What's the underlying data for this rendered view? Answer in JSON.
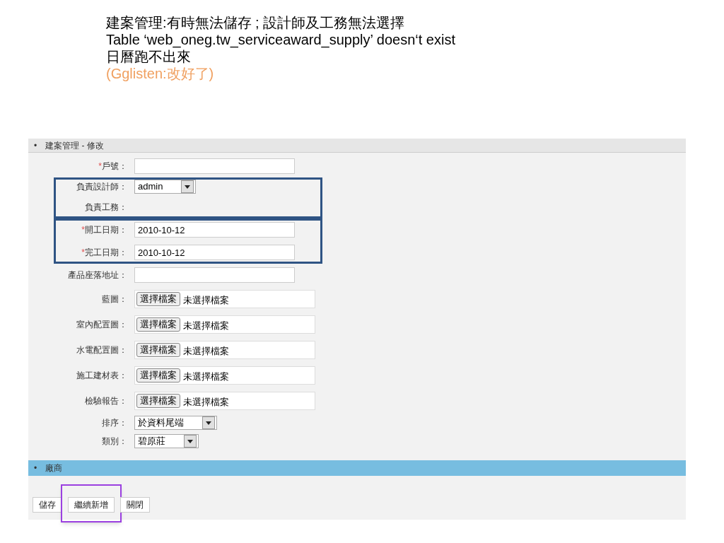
{
  "notes": [
    {
      "kind": "normal",
      "text": "建案管理:有時無法儲存 ; 設計師及工務無法選擇"
    },
    {
      "kind": "normal",
      "text": "Table ‘web_oneg.tw_serviceaward_supply’ doesn‘t exist"
    },
    {
      "kind": "normal",
      "text": "日曆跑不出來"
    },
    {
      "kind": "comment",
      "text": "(Gglisten:改好了)"
    }
  ],
  "form": {
    "title": "建案管理 - 修改",
    "groups": [
      {
        "framed": false,
        "fields": [
          {
            "label": "戶號",
            "required": true,
            "kind": "text"
          }
        ]
      },
      {
        "framed": true,
        "fields": [
          {
            "label": "負責設計師",
            "required": false,
            "kind": "select",
            "value": "admin"
          },
          {
            "label": "負責工務",
            "required": false,
            "kind": "empty"
          }
        ]
      },
      {
        "framed": true,
        "fields": [
          {
            "label": "開工日期",
            "required": true,
            "kind": "text",
            "value": "2010-10-12"
          },
          {
            "label": "完工日期",
            "required": true,
            "kind": "text",
            "value": "2010-10-12"
          }
        ]
      },
      {
        "framed": false,
        "fields": [
          {
            "label": "產品座落地址",
            "required": false,
            "kind": "text"
          },
          {
            "label": "藍圖",
            "required": false,
            "kind": "file",
            "button": "選擇檔案",
            "value": "未選擇檔案"
          },
          {
            "label": "室內配置圖",
            "required": false,
            "kind": "file",
            "button": "選擇檔案",
            "value": "未選擇檔案"
          },
          {
            "label": "水電配置圖",
            "required": false,
            "kind": "file",
            "button": "選擇檔案",
            "value": "未選擇檔案"
          },
          {
            "label": "施工建材表",
            "required": false,
            "kind": "file",
            "button": "選擇檔案",
            "value": "未選擇檔案"
          },
          {
            "label": "檢驗報告",
            "required": false,
            "kind": "file",
            "button": "選擇檔案",
            "value": "未選擇檔案"
          },
          {
            "label": "排序",
            "required": false,
            "kind": "select",
            "value": "於資料尾端"
          },
          {
            "label": "類別",
            "required": false,
            "kind": "select",
            "value": "碧原莊"
          }
        ]
      }
    ],
    "required_mark": "*",
    "colon": "：",
    "bullet": "•",
    "section": "廠商",
    "buttons": [
      {
        "label": "儲存",
        "highlighted": false
      },
      {
        "label": "繼續新增",
        "highlighted": true
      },
      {
        "label": "關閉",
        "highlighted": false
      }
    ]
  }
}
